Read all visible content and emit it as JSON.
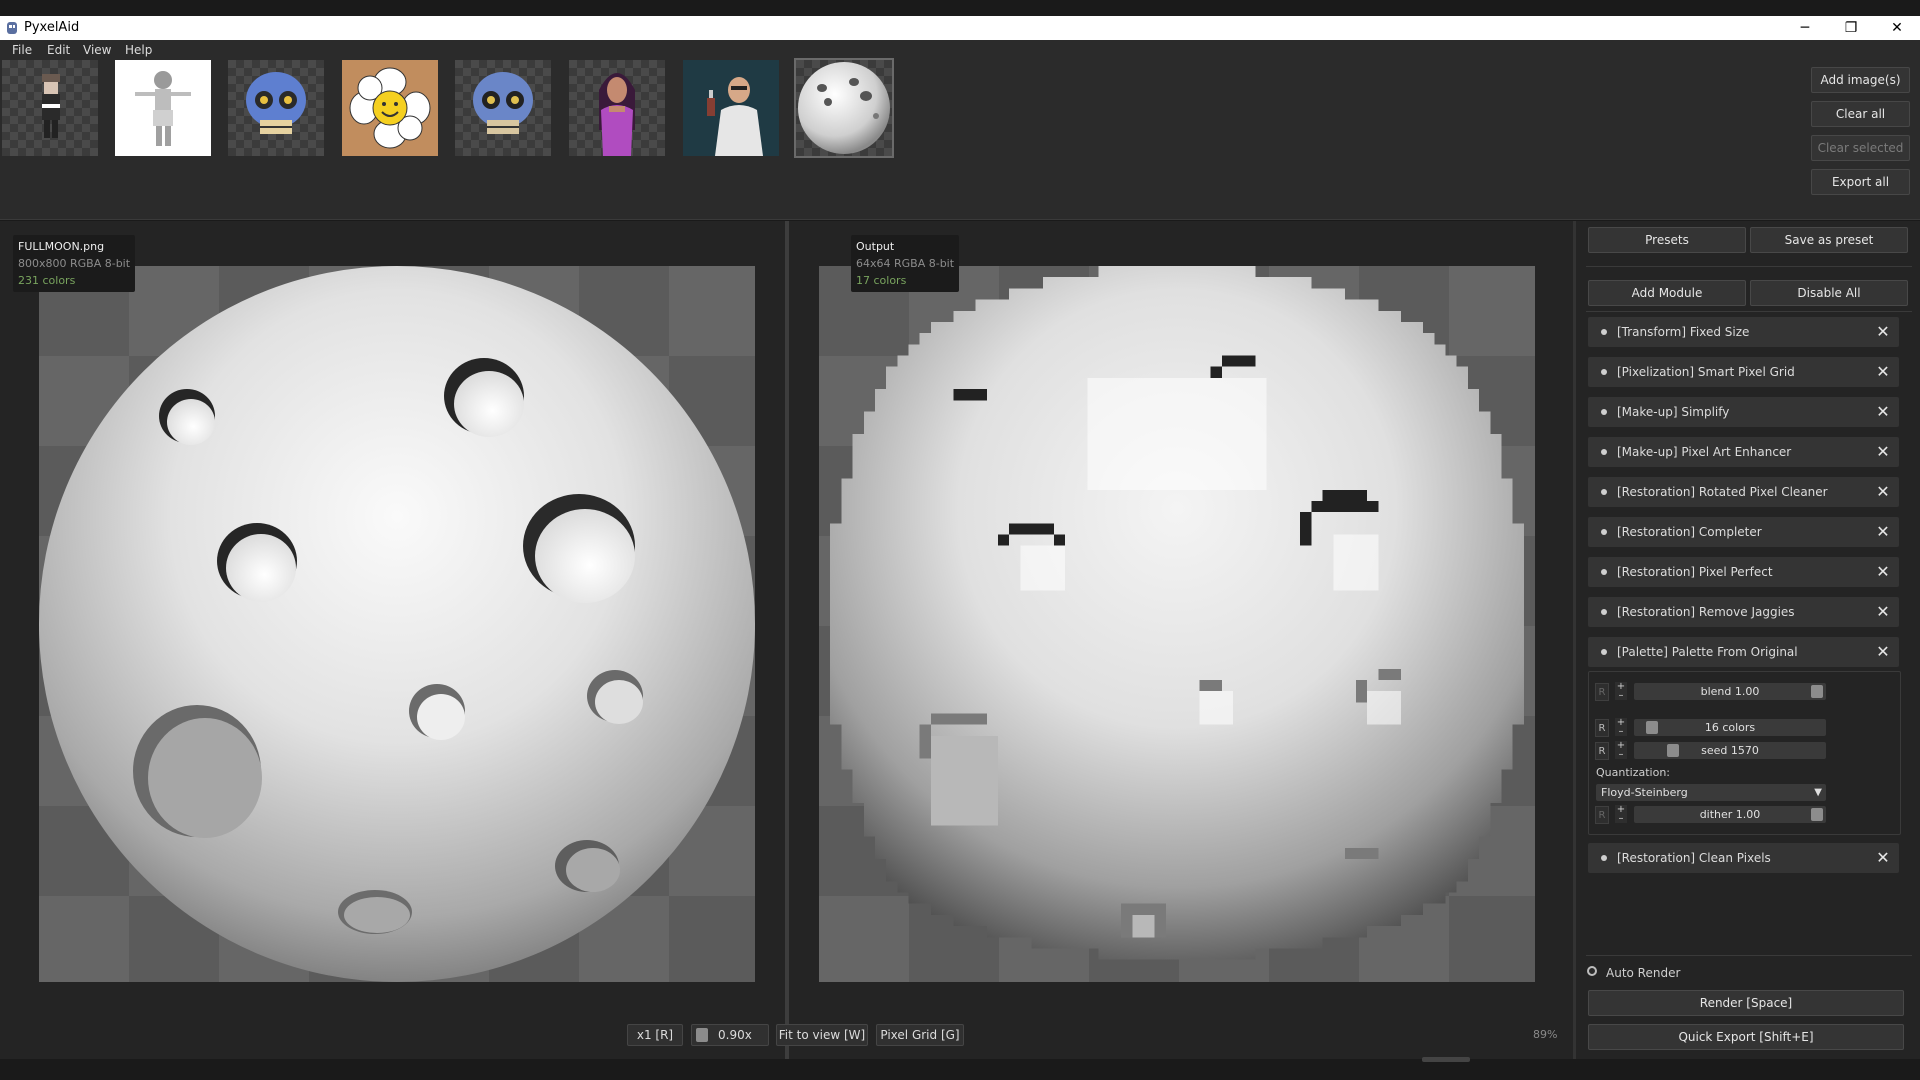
{
  "window": {
    "title": "PyxelAid",
    "minimize": "─",
    "restore": "❐",
    "close": "✕"
  },
  "menu": [
    "File",
    "Edit",
    "View",
    "Help"
  ],
  "gallery": {
    "add_images": "Add image(s)",
    "clear_all": "Clear all",
    "clear_selected": "Clear selected",
    "export_all": "Export all"
  },
  "input_image": {
    "filename": "FULLMOON.png",
    "meta": "800x800  RGBA  8-bit",
    "colors": "231 colors"
  },
  "output_image": {
    "title": "Output",
    "meta": "64x64  RGBA  8-bit",
    "colors": "17 colors"
  },
  "view_toolbar": {
    "scale": "x1 [R]",
    "zoom": "0.90x",
    "fit": "Fit to view [W]",
    "grid": "Pixel Grid [G]",
    "zoom_percent": "89%"
  },
  "sidebar": {
    "presets": "Presets",
    "save_preset": "Save as preset",
    "add_module": "Add Module",
    "disable_all": "Disable All",
    "modules": [
      "[Transform] Fixed Size",
      "[Pixelization] Smart Pixel Grid",
      "[Make-up] Simplify",
      "[Make-up] Pixel Art Enhancer",
      "[Restoration] Rotated Pixel Cleaner",
      "[Restoration] Completer",
      "[Restoration] Pixel Perfect",
      "[Restoration] Remove Jaggies",
      "[Palette] Palette From Original"
    ],
    "last_module": "[Restoration] Clean Pixels",
    "close_symbol": "✕",
    "params": {
      "r": "R",
      "blend": "blend 1.00",
      "colors": "16 colors",
      "seed": "seed 1570",
      "quantization_label": "Quantization:",
      "quantization_value": "Floyd-Steinberg",
      "dither": "dither 1.00"
    },
    "auto_render": "Auto Render",
    "render": "Render  [Space]",
    "quick_export": "Quick Export  [Shift+E]"
  }
}
